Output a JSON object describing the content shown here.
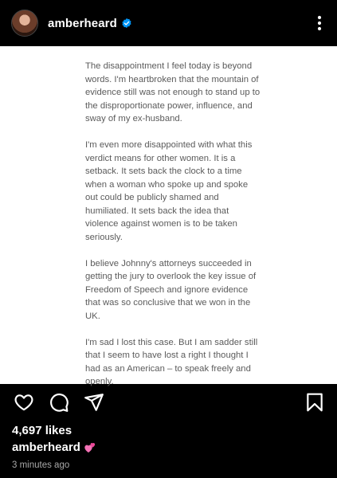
{
  "header": {
    "username": "amberheard",
    "verified": true,
    "more_icon": "more-vertical-icon"
  },
  "post": {
    "paragraphs": [
      "The disappointment I feel today is beyond words. I'm heartbroken that the mountain of evidence still was not enough to stand up to the disproportionate power, influence, and sway of my ex-husband.",
      "I'm even more disappointed with what this verdict means for other women. It is a setback. It sets back the clock to a time when a woman who spoke up and spoke out could be publicly shamed and humiliated. It sets back the idea that violence against women is to be taken seriously.",
      "I believe Johnny's attorneys succeeded in getting the jury to overlook the key issue of Freedom of Speech and ignore evidence that was so conclusive that we won in the UK.",
      "I'm sad I lost this case. But I am sadder still that I seem to have lost a right I thought I had as an American – to speak freely and openly."
    ]
  },
  "actions": {
    "like_icon": "heart-icon",
    "comment_icon": "comment-icon",
    "share_icon": "send-icon",
    "save_icon": "bookmark-icon"
  },
  "footer": {
    "likes": "4,697 likes",
    "caption_username": "amberheard",
    "caption_emoji": "pink-hearts-emoji",
    "timestamp": "3 minutes ago"
  },
  "colors": {
    "background": "#000000",
    "text": "#ffffff",
    "muted": "#a8a8a8",
    "verified": "#0095f6",
    "post_bg": "#ffffff",
    "post_text": "#5b5b5b"
  }
}
